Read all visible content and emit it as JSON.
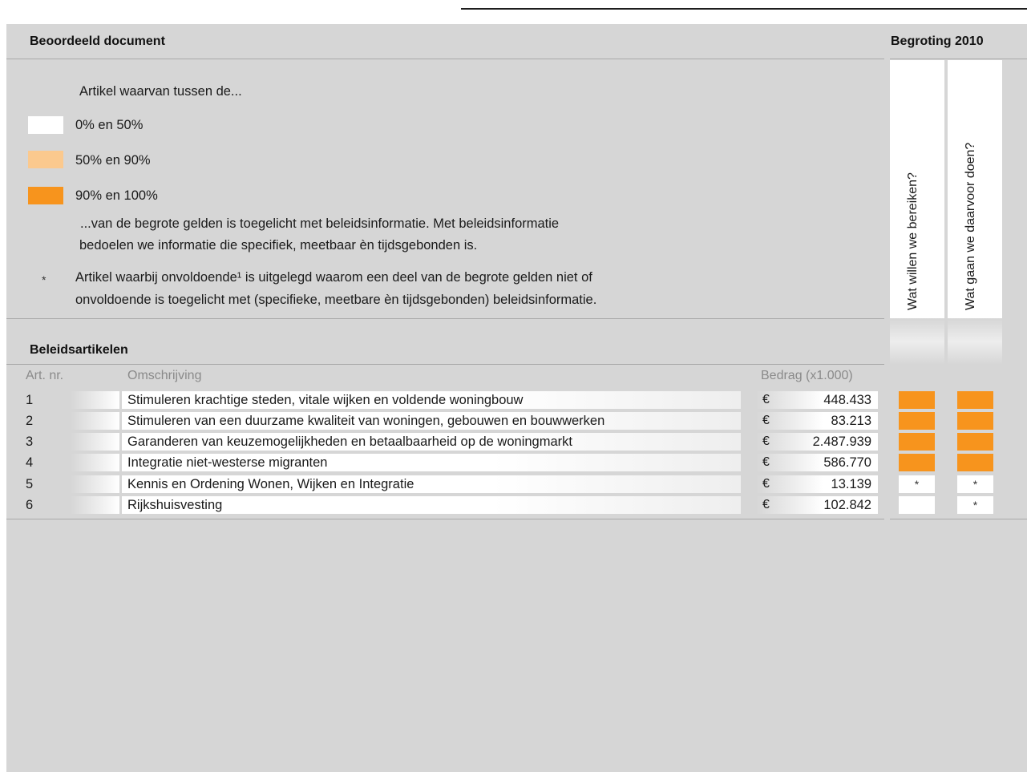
{
  "header": {
    "left_title": "Beoordeeld document",
    "right_title": "Begroting 2010"
  },
  "legend": {
    "intro": "Artikel waarvan tussen de...",
    "items": [
      {
        "label": "0% en 50%",
        "color": "#ffffff"
      },
      {
        "label": "50% en 90%",
        "color": "#fbc98e"
      },
      {
        "label": "90% en 100%",
        "color": "#f7941d"
      }
    ],
    "explanation_line1": "...van de begrote gelden is toegelicht met beleidsinformatie. Met beleidsinformatie",
    "explanation_line2": "bedoelen we informatie die specifiek, meetbaar èn tijdsgebonden is.",
    "asterisk": "*",
    "note_line1": "Artikel waarbij onvoldoende¹ is uitgelegd waarom een deel van de begrote gelden niet of",
    "note_line2": "onvoldoende is toegelicht met (specifieke, meetbare èn tijdsgebonden) beleidsinformatie."
  },
  "questions": {
    "col1": "Wat willen we bereiken?",
    "col2": "Wat gaan we daarvoor doen?"
  },
  "section": {
    "title": "Beleidsartikelen",
    "col_nr": "Art. nr.",
    "col_desc": "Omschrijving",
    "col_amount": "Bedrag (x1.000)"
  },
  "rows": [
    {
      "nr": "1",
      "desc": "Stimuleren krachtige steden, vitale wijken en voldende woningbouw",
      "currency": "€",
      "amount": "448.433",
      "c1": "full",
      "c1_text": "",
      "c2": "full",
      "c2_text": ""
    },
    {
      "nr": "2",
      "desc": "Stimuleren van een duurzame kwaliteit van woningen, gebouwen en bouwwerken",
      "currency": "€",
      "amount": "83.213",
      "c1": "full",
      "c1_text": "",
      "c2": "full",
      "c2_text": ""
    },
    {
      "nr": "3",
      "desc": "Garanderen van keuzemogelijkheden en betaalbaarheid op de woningmarkt",
      "currency": "€",
      "amount": "2.487.939",
      "c1": "full",
      "c1_text": "",
      "c2": "full",
      "c2_text": ""
    },
    {
      "nr": "4",
      "desc": "Integratie niet-westerse migranten",
      "currency": "€",
      "amount": "586.770",
      "c1": "full",
      "c1_text": "",
      "c2": "full",
      "c2_text": ""
    },
    {
      "nr": "5",
      "desc": "Kennis en Ordening Wonen, Wijken en Integratie",
      "currency": "€",
      "amount": "13.139",
      "c1": "low",
      "c1_text": "*",
      "c2": "low",
      "c2_text": "*"
    },
    {
      "nr": "6",
      "desc": "Rijkshuisvesting",
      "currency": "€",
      "amount": "102.842",
      "c1": "low",
      "c1_text": "",
      "c2": "low",
      "c2_text": "*"
    }
  ]
}
